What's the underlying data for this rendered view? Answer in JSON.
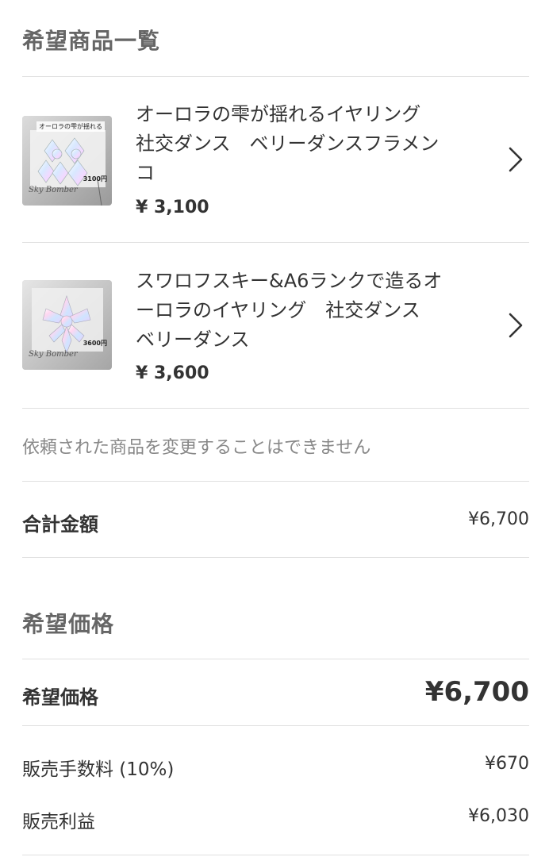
{
  "wish_items": {
    "title": "希望商品一覧",
    "items": [
      {
        "name_line1": "オーロラの雫が揺れるイヤリング",
        "name_line2": "社交ダンス　ベリーダンスフラメン",
        "name_line3": "コ",
        "price": "¥ 3,100",
        "thumb_label": "オーロラの雫が揺れる",
        "thumb_price": "3100円",
        "thumb_sign": "Sky Bomber"
      },
      {
        "name_line1": "スワロフスキー&A6ランクで造るオ",
        "name_line2": "ーロラのイヤリング　社交ダンス",
        "name_line3": "ベリーダンス",
        "price": "¥ 3,600",
        "thumb_price": "3600円",
        "thumb_sign": "Sky Bomber"
      }
    ],
    "note": "依頼された商品を変更することはできません"
  },
  "total": {
    "label": "合計金額",
    "value": "¥6,700"
  },
  "desired_price": {
    "title": "希望価格",
    "label": "希望価格",
    "value": "¥6,700"
  },
  "fee": {
    "label": "販売手数料 (10%)",
    "value": "¥670"
  },
  "profit": {
    "label": "販売利益",
    "value": "¥6,030"
  },
  "icons": {
    "chevron": "chevron-right-icon"
  },
  "colors": {
    "divider": "#e0e0e0",
    "muted_text": "#888888",
    "text": "#333333"
  }
}
